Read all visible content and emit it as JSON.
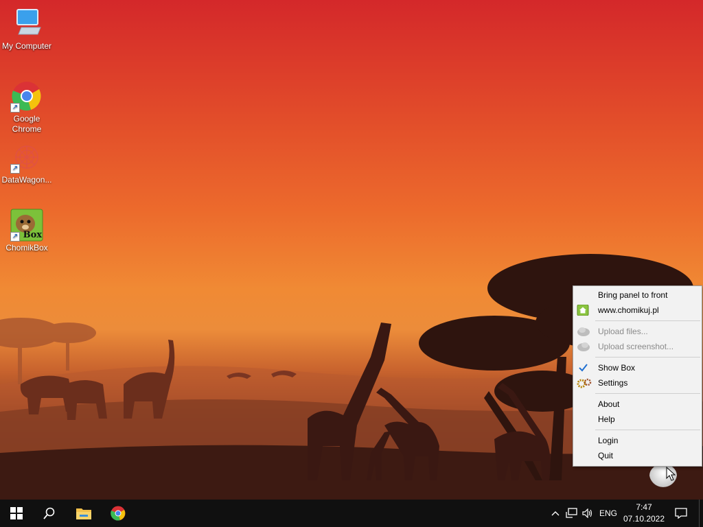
{
  "desktop_icons": [
    {
      "label": "My Computer",
      "icon": "computer-monitor-icon"
    },
    {
      "label": "Google Chrome",
      "icon": "chrome-icon"
    },
    {
      "label": "DataWagon...",
      "icon": "datawagon-icon"
    },
    {
      "label": "ChomikBox",
      "icon": "chomikbox-hamster-icon",
      "badge": "Box"
    }
  ],
  "context_menu": {
    "items": [
      {
        "label": "Bring panel to front",
        "enabled": true,
        "icon": null
      },
      {
        "label": "www.chomikuj.pl",
        "enabled": true,
        "icon": "home-icon"
      },
      {
        "label": "Upload files...",
        "enabled": false,
        "icon": "upload-icon"
      },
      {
        "label": "Upload screenshot...",
        "enabled": false,
        "icon": "screenshot-icon"
      },
      {
        "label": "Show Box",
        "enabled": true,
        "checked": true,
        "icon": "check-icon"
      },
      {
        "label": "Settings",
        "enabled": true,
        "icon": "settings-gears-icon"
      },
      {
        "label": "About",
        "enabled": true,
        "icon": null
      },
      {
        "label": "Help",
        "enabled": true,
        "icon": null
      },
      {
        "label": "Login",
        "enabled": true,
        "icon": null
      },
      {
        "label": "Quit",
        "enabled": true,
        "icon": null
      }
    ]
  },
  "taskbar": {
    "pinned": [
      "windows-start-icon",
      "search-icon",
      "file-explorer-icon",
      "chrome-icon"
    ],
    "tray": {
      "language": "ENG",
      "time": "7:47",
      "date": "07.10.2022",
      "icons": [
        "chevron-up-icon",
        "network-icon",
        "volume-icon",
        "notification-icon"
      ]
    }
  },
  "colors": {
    "taskbar": "#101010",
    "menu_background": "#f2f2f2",
    "check_accent": "#1f6fd1",
    "sky_top": "#d4282a",
    "sky_horizon": "#f08a34"
  }
}
